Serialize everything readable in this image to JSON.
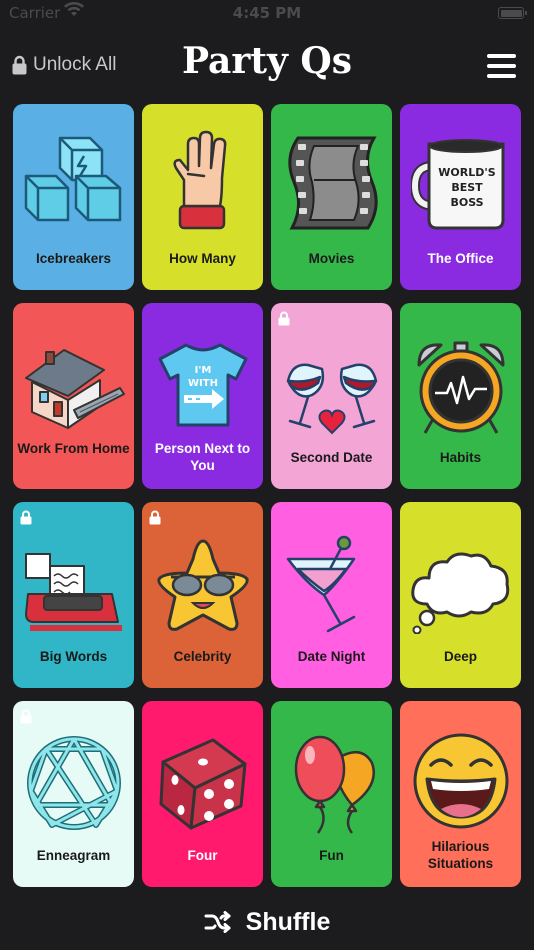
{
  "status_bar": {
    "carrier": "Carrier",
    "time": "4:45 PM"
  },
  "header": {
    "unlock_label": "Unlock All",
    "title": "Party Qs"
  },
  "cards": [
    {
      "label": "Icebreakers",
      "bg": "#5ab0e4",
      "locked": false,
      "icon": "ice-cubes-icon"
    },
    {
      "label": "How Many",
      "bg": "#d6e02a",
      "locked": false,
      "icon": "hand-counting-icon"
    },
    {
      "label": "Movies",
      "bg": "#35b84a",
      "locked": false,
      "icon": "film-strip-icon"
    },
    {
      "label": "The Office",
      "bg": "#8a2be2",
      "locked": false,
      "icon": "boss-mug-icon",
      "mug_text": "WORLD'S BEST BOSS"
    },
    {
      "label": "Work From Home",
      "bg": "#f25656",
      "locked": false,
      "icon": "house-laptop-icon"
    },
    {
      "label": "Person Next to You",
      "bg": "#8a2be2",
      "locked": false,
      "icon": "im-with-shirt-icon",
      "shirt_text": "I'M WITH"
    },
    {
      "label": "Second Date",
      "bg": "#f3a5d6",
      "locked": true,
      "icon": "wine-glasses-heart-icon"
    },
    {
      "label": "Habits",
      "bg": "#35b84a",
      "locked": false,
      "icon": "alarm-clock-icon"
    },
    {
      "label": "Big Words",
      "bg": "#30b6c6",
      "locked": true,
      "icon": "typewriter-icon"
    },
    {
      "label": "Celebrity",
      "bg": "#dc6338",
      "locked": true,
      "icon": "star-sunglasses-icon"
    },
    {
      "label": "Date Night",
      "bg": "#ff5fe0",
      "locked": false,
      "icon": "martini-icon"
    },
    {
      "label": "Deep",
      "bg": "#d6e02a",
      "locked": false,
      "icon": "thought-cloud-icon"
    },
    {
      "label": "Enneagram",
      "bg": "#e6fbf6",
      "locked": true,
      "icon": "enneagram-icon"
    },
    {
      "label": "Four",
      "bg": "#ff1a6e",
      "locked": false,
      "icon": "dice-icon"
    },
    {
      "label": "Fun",
      "bg": "#35b84a",
      "locked": false,
      "icon": "balloons-icon"
    },
    {
      "label": "Hilarious Situations",
      "bg": "#ff6f5a",
      "locked": false,
      "icon": "laughing-emoji-icon"
    }
  ],
  "footer": {
    "shuffle_label": "Shuffle"
  }
}
